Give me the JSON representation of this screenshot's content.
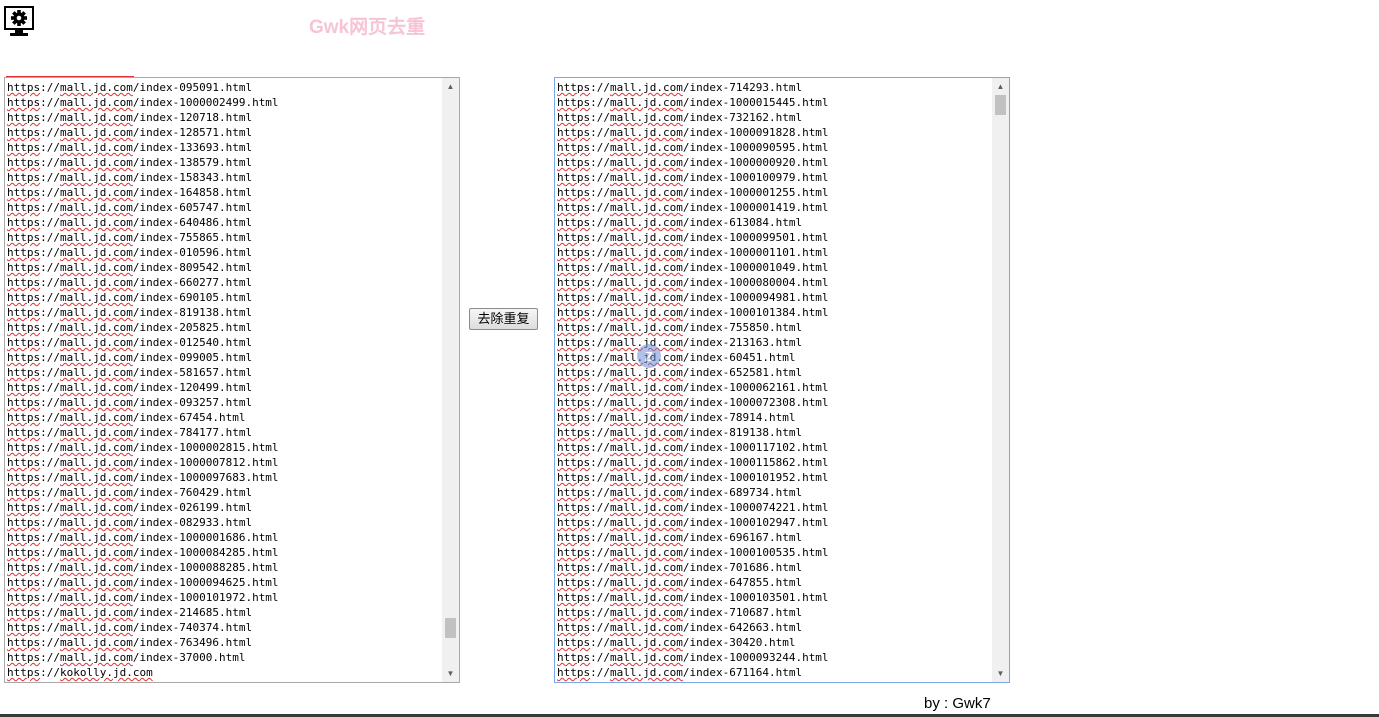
{
  "app": {
    "title": "Gwk网页去重",
    "icon": "gear-monitor-icon"
  },
  "button": {
    "dedupe_label": "去除重复"
  },
  "footer": {
    "credit": "by : Gwk7"
  },
  "left": {
    "lines": [
      "https://mall.jd.com/index-095091.html",
      "https://mall.jd.com/index-1000002499.html",
      "https://mall.jd.com/index-120718.html",
      "https://mall.jd.com/index-128571.html",
      "https://mall.jd.com/index-133693.html",
      "https://mall.jd.com/index-138579.html",
      "https://mall.jd.com/index-158343.html",
      "https://mall.jd.com/index-164858.html",
      "https://mall.jd.com/index-605747.html",
      "https://mall.jd.com/index-640486.html",
      "https://mall.jd.com/index-755865.html",
      "https://mall.jd.com/index-010596.html",
      "https://mall.jd.com/index-809542.html",
      "https://mall.jd.com/index-660277.html",
      "https://mall.jd.com/index-690105.html",
      "https://mall.jd.com/index-819138.html",
      "https://mall.jd.com/index-205825.html",
      "https://mall.jd.com/index-012540.html",
      "https://mall.jd.com/index-099005.html",
      "https://mall.jd.com/index-581657.html",
      "https://mall.jd.com/index-120499.html",
      "https://mall.jd.com/index-093257.html",
      "https://mall.jd.com/index-67454.html",
      "https://mall.jd.com/index-784177.html",
      "https://mall.jd.com/index-1000002815.html",
      "https://mall.jd.com/index-1000007812.html",
      "https://mall.jd.com/index-1000097683.html",
      "https://mall.jd.com/index-760429.html",
      "https://mall.jd.com/index-026199.html",
      "https://mall.jd.com/index-082933.html",
      "https://mall.jd.com/index-1000001686.html",
      "https://mall.jd.com/index-1000084285.html",
      "https://mall.jd.com/index-1000088285.html",
      "https://mall.jd.com/index-1000094625.html",
      "https://mall.jd.com/index-1000101972.html",
      "https://mall.jd.com/index-214685.html",
      "https://mall.jd.com/index-740374.html",
      "https://mall.jd.com/index-763496.html",
      "https://mall.jd.com/index-37000.html",
      "https://kokolly.jd.com"
    ],
    "scroll_position": 0.95
  },
  "right": {
    "lines": [
      "https://mall.jd.com/index-714293.html",
      "https://mall.jd.com/index-1000015445.html",
      "https://mall.jd.com/index-732162.html",
      "https://mall.jd.com/index-1000091828.html",
      "https://mall.jd.com/index-1000090595.html",
      "https://mall.jd.com/index-1000000920.html",
      "https://mall.jd.com/index-1000100979.html",
      "https://mall.jd.com/index-1000001255.html",
      "https://mall.jd.com/index-1000001419.html",
      "https://mall.jd.com/index-613084.html",
      "https://mall.jd.com/index-1000099501.html",
      "https://mall.jd.com/index-1000001101.html",
      "https://mall.jd.com/index-1000001049.html",
      "https://mall.jd.com/index-1000080004.html",
      "https://mall.jd.com/index-1000094981.html",
      "https://mall.jd.com/index-1000101384.html",
      "https://mall.jd.com/index-755850.html",
      "https://mall.jd.com/index-213163.html",
      "https://mall.jd.com/index-60451.html",
      "https://mall.jd.com/index-652581.html",
      "https://mall.jd.com/index-1000062161.html",
      "https://mall.jd.com/index-1000072308.html",
      "https://mall.jd.com/index-78914.html",
      "https://mall.jd.com/index-819138.html",
      "https://mall.jd.com/index-1000117102.html",
      "https://mall.jd.com/index-1000115862.html",
      "https://mall.jd.com/index-1000101952.html",
      "https://mall.jd.com/index-689734.html",
      "https://mall.jd.com/index-1000074221.html",
      "https://mall.jd.com/index-1000102947.html",
      "https://mall.jd.com/index-696167.html",
      "https://mall.jd.com/index-1000100535.html",
      "https://mall.jd.com/index-701686.html",
      "https://mall.jd.com/index-647855.html",
      "https://mall.jd.com/index-1000103501.html",
      "https://mall.jd.com/index-710687.html",
      "https://mall.jd.com/index-642663.html",
      "https://mall.jd.com/index-30420.html",
      "https://mall.jd.com/index-1000093244.html",
      "https://mall.jd.com/index-671164.html"
    ],
    "scroll_position": 0.0
  },
  "colors": {
    "title": "#f7c4d4",
    "focus_border": "#7aa7e8",
    "spell_underline": "#e03030"
  }
}
